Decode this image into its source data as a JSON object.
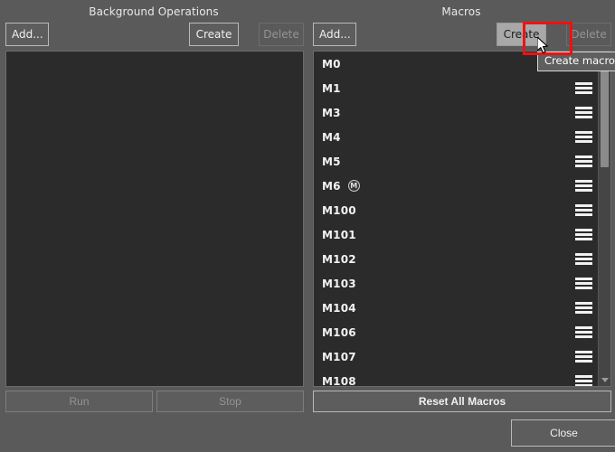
{
  "window": {
    "background_color": "#5a5a5a",
    "list_background_color": "#2b2b2b",
    "accent_highlight_color": "#ee1111"
  },
  "background_operations": {
    "title": "Background Operations",
    "toolbar": {
      "add_label": "Add...",
      "create_label": "Create",
      "delete_label": "Delete"
    },
    "items": [],
    "footer": {
      "run_label": "Run",
      "stop_label": "Stop"
    }
  },
  "macros": {
    "title": "Macros",
    "toolbar": {
      "add_label": "Add...",
      "create_label": "Create",
      "delete_label": "Delete"
    },
    "items": [
      {
        "label": "M0",
        "badge": "",
        "menu_icon": "hamburger-menu-icon",
        "has_menu": false
      },
      {
        "label": "M1",
        "badge": "",
        "menu_icon": "hamburger-menu-icon",
        "has_menu": true
      },
      {
        "label": "M3",
        "badge": "",
        "menu_icon": "hamburger-menu-icon",
        "has_menu": true
      },
      {
        "label": "M4",
        "badge": "",
        "menu_icon": "hamburger-menu-icon",
        "has_menu": true
      },
      {
        "label": "M5",
        "badge": "",
        "menu_icon": "hamburger-menu-icon",
        "has_menu": true
      },
      {
        "label": "M6",
        "badge": "M",
        "menu_icon": "hamburger-menu-icon",
        "has_menu": true
      },
      {
        "label": "M100",
        "badge": "",
        "menu_icon": "hamburger-menu-icon",
        "has_menu": true
      },
      {
        "label": "M101",
        "badge": "",
        "menu_icon": "hamburger-menu-icon",
        "has_menu": true
      },
      {
        "label": "M102",
        "badge": "",
        "menu_icon": "hamburger-menu-icon",
        "has_menu": true
      },
      {
        "label": "M103",
        "badge": "",
        "menu_icon": "hamburger-menu-icon",
        "has_menu": true
      },
      {
        "label": "M104",
        "badge": "",
        "menu_icon": "hamburger-menu-icon",
        "has_menu": true
      },
      {
        "label": "M106",
        "badge": "",
        "menu_icon": "hamburger-menu-icon",
        "has_menu": true
      },
      {
        "label": "M107",
        "badge": "",
        "menu_icon": "hamburger-menu-icon",
        "has_menu": true
      },
      {
        "label": "M108",
        "badge": "",
        "menu_icon": "hamburger-menu-icon",
        "has_menu": true
      }
    ],
    "footer": {
      "reset_label": "Reset All Macros"
    }
  },
  "tooltip": {
    "text": "Create macro"
  },
  "dialog": {
    "close_label": "Close"
  }
}
